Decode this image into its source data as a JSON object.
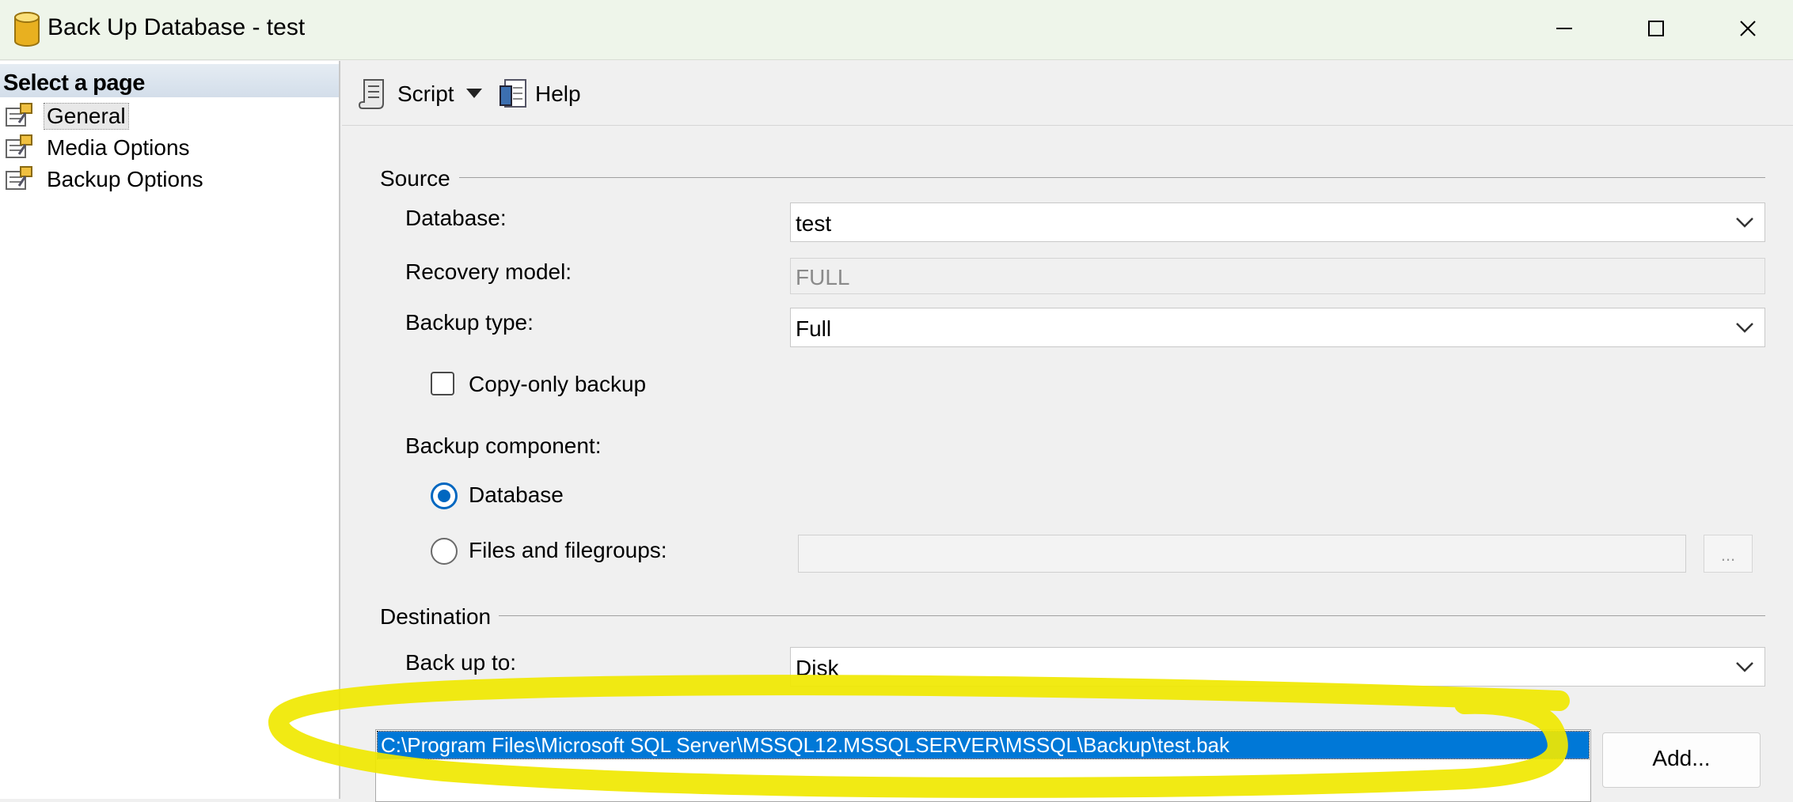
{
  "window": {
    "title": "Back Up Database - test"
  },
  "left_pane": {
    "header": "Select a page",
    "pages": [
      {
        "label": "General",
        "selected": true
      },
      {
        "label": "Media Options",
        "selected": false
      },
      {
        "label": "Backup Options",
        "selected": false
      }
    ]
  },
  "toolbar": {
    "script_label": "Script",
    "help_label": "Help"
  },
  "source": {
    "title": "Source",
    "database_label": "Database:",
    "database_value": "test",
    "recovery_label": "Recovery model:",
    "recovery_value": "FULL",
    "backup_type_label": "Backup type:",
    "backup_type_value": "Full",
    "copy_only_label": "Copy-only backup",
    "copy_only_checked": false,
    "component_label": "Backup component:",
    "component_database_label": "Database",
    "component_files_label": "Files and filegroups:",
    "component_selected": "Database",
    "ellipsis_label": "..."
  },
  "destination": {
    "title": "Destination",
    "backup_to_label": "Back up to:",
    "backup_to_value": "Disk",
    "paths": [
      "C:\\Program Files\\Microsoft SQL Server\\MSSQL12.MSSQLSERVER\\MSSQL\\Backup\\test.bak"
    ],
    "add_label": "Add..."
  },
  "colors": {
    "highlight": "#0078d7",
    "radio_accent": "#0067c0",
    "annotation": "#f0e800",
    "titlebar": "#eef5ea"
  },
  "icons": [
    "database-icon",
    "minimize-icon",
    "maximize-icon",
    "close-icon",
    "page-properties-icon",
    "script-icon",
    "dropdown-arrow-icon",
    "help-icon",
    "chevron-down-icon"
  ]
}
